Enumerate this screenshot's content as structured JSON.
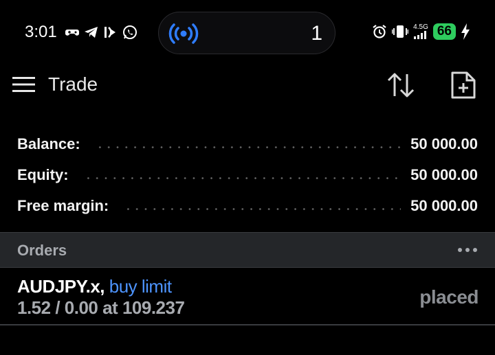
{
  "status_bar": {
    "time": "3:01",
    "notification_icons": [
      "game-controller-icon",
      "telegram-icon",
      "signal-app-icon",
      "whatsapp-icon"
    ],
    "live_activity_count": "1",
    "network_type": "4.5G",
    "battery_level": "66",
    "battery_color": "#2ecc5e"
  },
  "app_bar": {
    "title": "Trade"
  },
  "summary": {
    "balance_label": "Balance:",
    "balance_value": "50 000.00",
    "equity_label": "Equity:",
    "equity_value": "50 000.00",
    "free_margin_label": "Free margin:",
    "free_margin_value": "50 000.00"
  },
  "orders": {
    "header_label": "Orders",
    "items": [
      {
        "symbol": "AUDJPY.x,",
        "type": "buy limit",
        "volume_price": "1.52 / 0.00 at 109.237",
        "state": "placed"
      }
    ]
  },
  "colors": {
    "accent_blue": "#4d94ff",
    "header_bg": "#242629",
    "muted_text": "#a8abb0"
  }
}
